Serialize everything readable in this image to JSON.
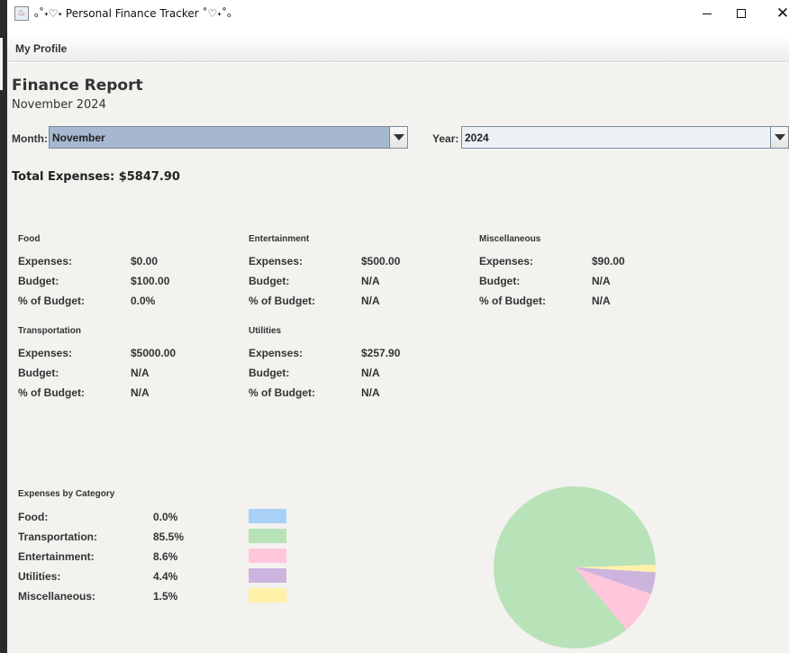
{
  "window": {
    "title": "ₒ˚˖♡˖ Personal Finance Tracker ˚♡˖˚ₒ",
    "app_icon": "java-cup-icon",
    "minimize": "minimize-icon",
    "maximize": "maximize-icon",
    "close": "close-icon"
  },
  "menubar": {
    "my_profile": "My Profile"
  },
  "report": {
    "title": "Finance Report",
    "subtitle": "November 2024",
    "month_label": "Month:",
    "month_value": "November",
    "year_label": "Year:",
    "year_value": "2024",
    "total_expenses": "Total Expenses: $5847.90"
  },
  "categories": [
    {
      "name": "Food",
      "expenses_label": "Expenses:",
      "expenses": "$0.00",
      "budget_label": "Budget:",
      "budget": "$100.00",
      "pct_label": "% of Budget:",
      "pct": "0.0%"
    },
    {
      "name": "Entertainment",
      "expenses_label": "Expenses:",
      "expenses": "$500.00",
      "budget_label": "Budget:",
      "budget": "N/A",
      "pct_label": "% of Budget:",
      "pct": "N/A"
    },
    {
      "name": "Miscellaneous",
      "expenses_label": "Expenses:",
      "expenses": "$90.00",
      "budget_label": "Budget:",
      "budget": "N/A",
      "pct_label": "% of Budget:",
      "pct": "N/A"
    },
    {
      "name": "Transportation",
      "expenses_label": "Expenses:",
      "expenses": "$5000.00",
      "budget_label": "Budget:",
      "budget": "N/A",
      "pct_label": "% of Budget:",
      "pct": "N/A"
    },
    {
      "name": "Utilities",
      "expenses_label": "Expenses:",
      "expenses": "$257.90",
      "budget_label": "Budget:",
      "budget": "N/A",
      "pct_label": "% of Budget:",
      "pct": "N/A"
    }
  ],
  "legend": {
    "title": "Expenses by Category",
    "items": [
      {
        "label": "Food:",
        "pct": "0.0%",
        "color": "#a9d1f7"
      },
      {
        "label": "Transportation:",
        "pct": "85.5%",
        "color": "#b8e2b8"
      },
      {
        "label": "Entertainment:",
        "pct": "8.6%",
        "color": "#ffc6dc"
      },
      {
        "label": "Utilities:",
        "pct": "4.4%",
        "color": "#ccb4de"
      },
      {
        "label": "Miscellaneous:",
        "pct": "1.5%",
        "color": "#fff2a8"
      }
    ]
  },
  "chart_data": {
    "type": "pie",
    "labels": [
      "Food",
      "Transportation",
      "Entertainment",
      "Utilities",
      "Miscellaneous"
    ],
    "values": [
      0.0,
      85.5,
      8.6,
      4.4,
      1.5
    ],
    "colors": [
      "#a9d1f7",
      "#b8e2b8",
      "#ffc6dc",
      "#ccb4de",
      "#fff2a8"
    ]
  }
}
